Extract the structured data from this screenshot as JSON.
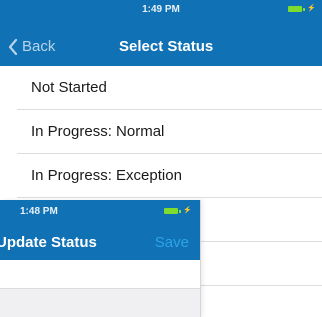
{
  "back_screen": {
    "status_bar": {
      "time": "1:49 PM"
    },
    "nav": {
      "back_label": "Back",
      "title": "Select Status"
    },
    "options": [
      {
        "label": "Not Started"
      },
      {
        "label": "In Progress: Normal"
      },
      {
        "label": "In Progress: Exception"
      },
      {
        "label": ""
      },
      {
        "label": ""
      }
    ]
  },
  "front_screen": {
    "status_bar": {
      "time": "1:48 PM"
    },
    "nav": {
      "title": "Update Status",
      "save_label": "Save"
    }
  },
  "colors": {
    "nav_bar": "#1071b5",
    "save": "#2da4e8",
    "battery": "#7ddc2e"
  },
  "icons": {
    "back": "chevron-left-icon",
    "battery": "battery-charging-icon"
  }
}
